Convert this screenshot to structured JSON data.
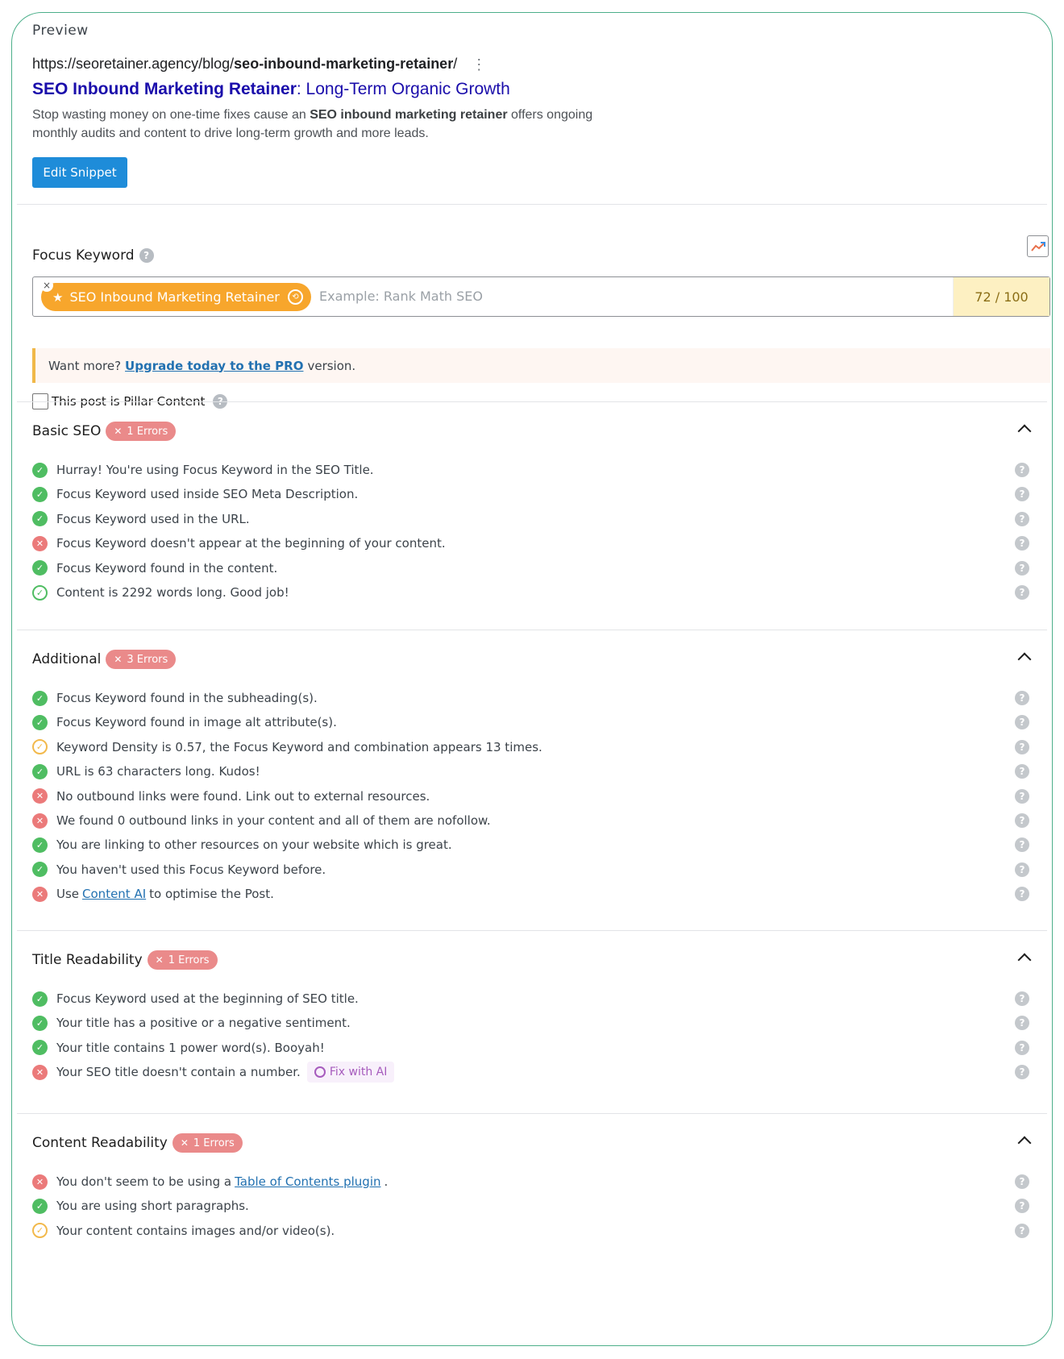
{
  "preview": {
    "label": "Preview",
    "url_base": "https://seoretainer.agency/blog/",
    "url_slug": "seo-inbound-marketing-retainer",
    "url_end": "/",
    "more_icon": "three-dots-vertical-icon",
    "title_bold": "SEO Inbound Marketing Retainer",
    "title_rest": ": Long-Term Organic Growth",
    "desc_pre": "Stop wasting money on one-time fixes cause an ",
    "desc_bold": "SEO inbound marketing retainer",
    "desc_post": " offers ongoing monthly audits and content to drive long-term growth and more leads.",
    "edit_button": "Edit Snippet"
  },
  "focus": {
    "label": "Focus Keyword",
    "help": "?",
    "trend_icon": "trend-chart-icon",
    "keyword": "SEO Inbound Marketing Retainer",
    "close": "×",
    "placeholder": "Example: Rank Math SEO",
    "score": "72 / 100",
    "upgrade_pre": "Want more?",
    "upgrade_link": "Upgrade today to the PRO",
    "upgrade_post": "version.",
    "pillar_label": "This post is Pillar Content"
  },
  "colors": {
    "accent": "#1e8cd9",
    "ok": "#4fbd62",
    "error": "#eb7a7a",
    "warning": "#f2b94c",
    "keyword_chip": "#f7a62c"
  },
  "sections": [
    {
      "title": "Basic SEO",
      "badge": "1 Errors",
      "items": [
        {
          "status": "ok",
          "text": "Hurray! You're using Focus Keyword in the SEO Title."
        },
        {
          "status": "ok",
          "text": "Focus Keyword used inside SEO Meta Description."
        },
        {
          "status": "ok",
          "text": "Focus Keyword used in the URL."
        },
        {
          "status": "error",
          "text": "Focus Keyword doesn't appear at the beginning of your content."
        },
        {
          "status": "ok",
          "text": "Focus Keyword found in the content."
        },
        {
          "status": "ok-outline",
          "text": "Content is 2292 words long. Good job!"
        }
      ]
    },
    {
      "title": "Additional",
      "badge": "3 Errors",
      "items": [
        {
          "status": "ok",
          "text": "Focus Keyword found in the subheading(s)."
        },
        {
          "status": "ok",
          "text": "Focus Keyword found in image alt attribute(s)."
        },
        {
          "status": "warning",
          "text": "Keyword Density is 0.57, the Focus Keyword and combination appears 13 times."
        },
        {
          "status": "ok",
          "text": "URL is 63 characters long. Kudos!"
        },
        {
          "status": "error",
          "text": "No outbound links were found. Link out to external resources."
        },
        {
          "status": "error",
          "text": "We found 0 outbound links in your content and all of them are nofollow."
        },
        {
          "status": "ok",
          "text": "You are linking to other resources on your website which is great."
        },
        {
          "status": "ok",
          "text": "You haven't used this Focus Keyword before."
        },
        {
          "status": "error",
          "text_pre": "Use",
          "link": "Content AI",
          "text_post": "to optimise the Post."
        }
      ]
    },
    {
      "title": "Title Readability",
      "badge": "1 Errors",
      "items": [
        {
          "status": "ok",
          "text": "Focus Keyword used at the beginning of SEO title."
        },
        {
          "status": "ok",
          "text": "Your title has a positive or a negative sentiment."
        },
        {
          "status": "ok",
          "text": "Your title contains 1 power word(s). Booyah!"
        },
        {
          "status": "error",
          "text": "Your SEO title doesn't contain a number.",
          "fix": "Fix with AI"
        }
      ]
    },
    {
      "title": "Content Readability",
      "badge": "1 Errors",
      "items": [
        {
          "status": "error",
          "text_pre": "You don't seem to be using a",
          "link": "Table of Contents plugin",
          "text_post": "."
        },
        {
          "status": "ok",
          "text": "You are using short paragraphs."
        },
        {
          "status": "warning",
          "text": "Your content contains images and/or video(s)."
        }
      ]
    }
  ]
}
